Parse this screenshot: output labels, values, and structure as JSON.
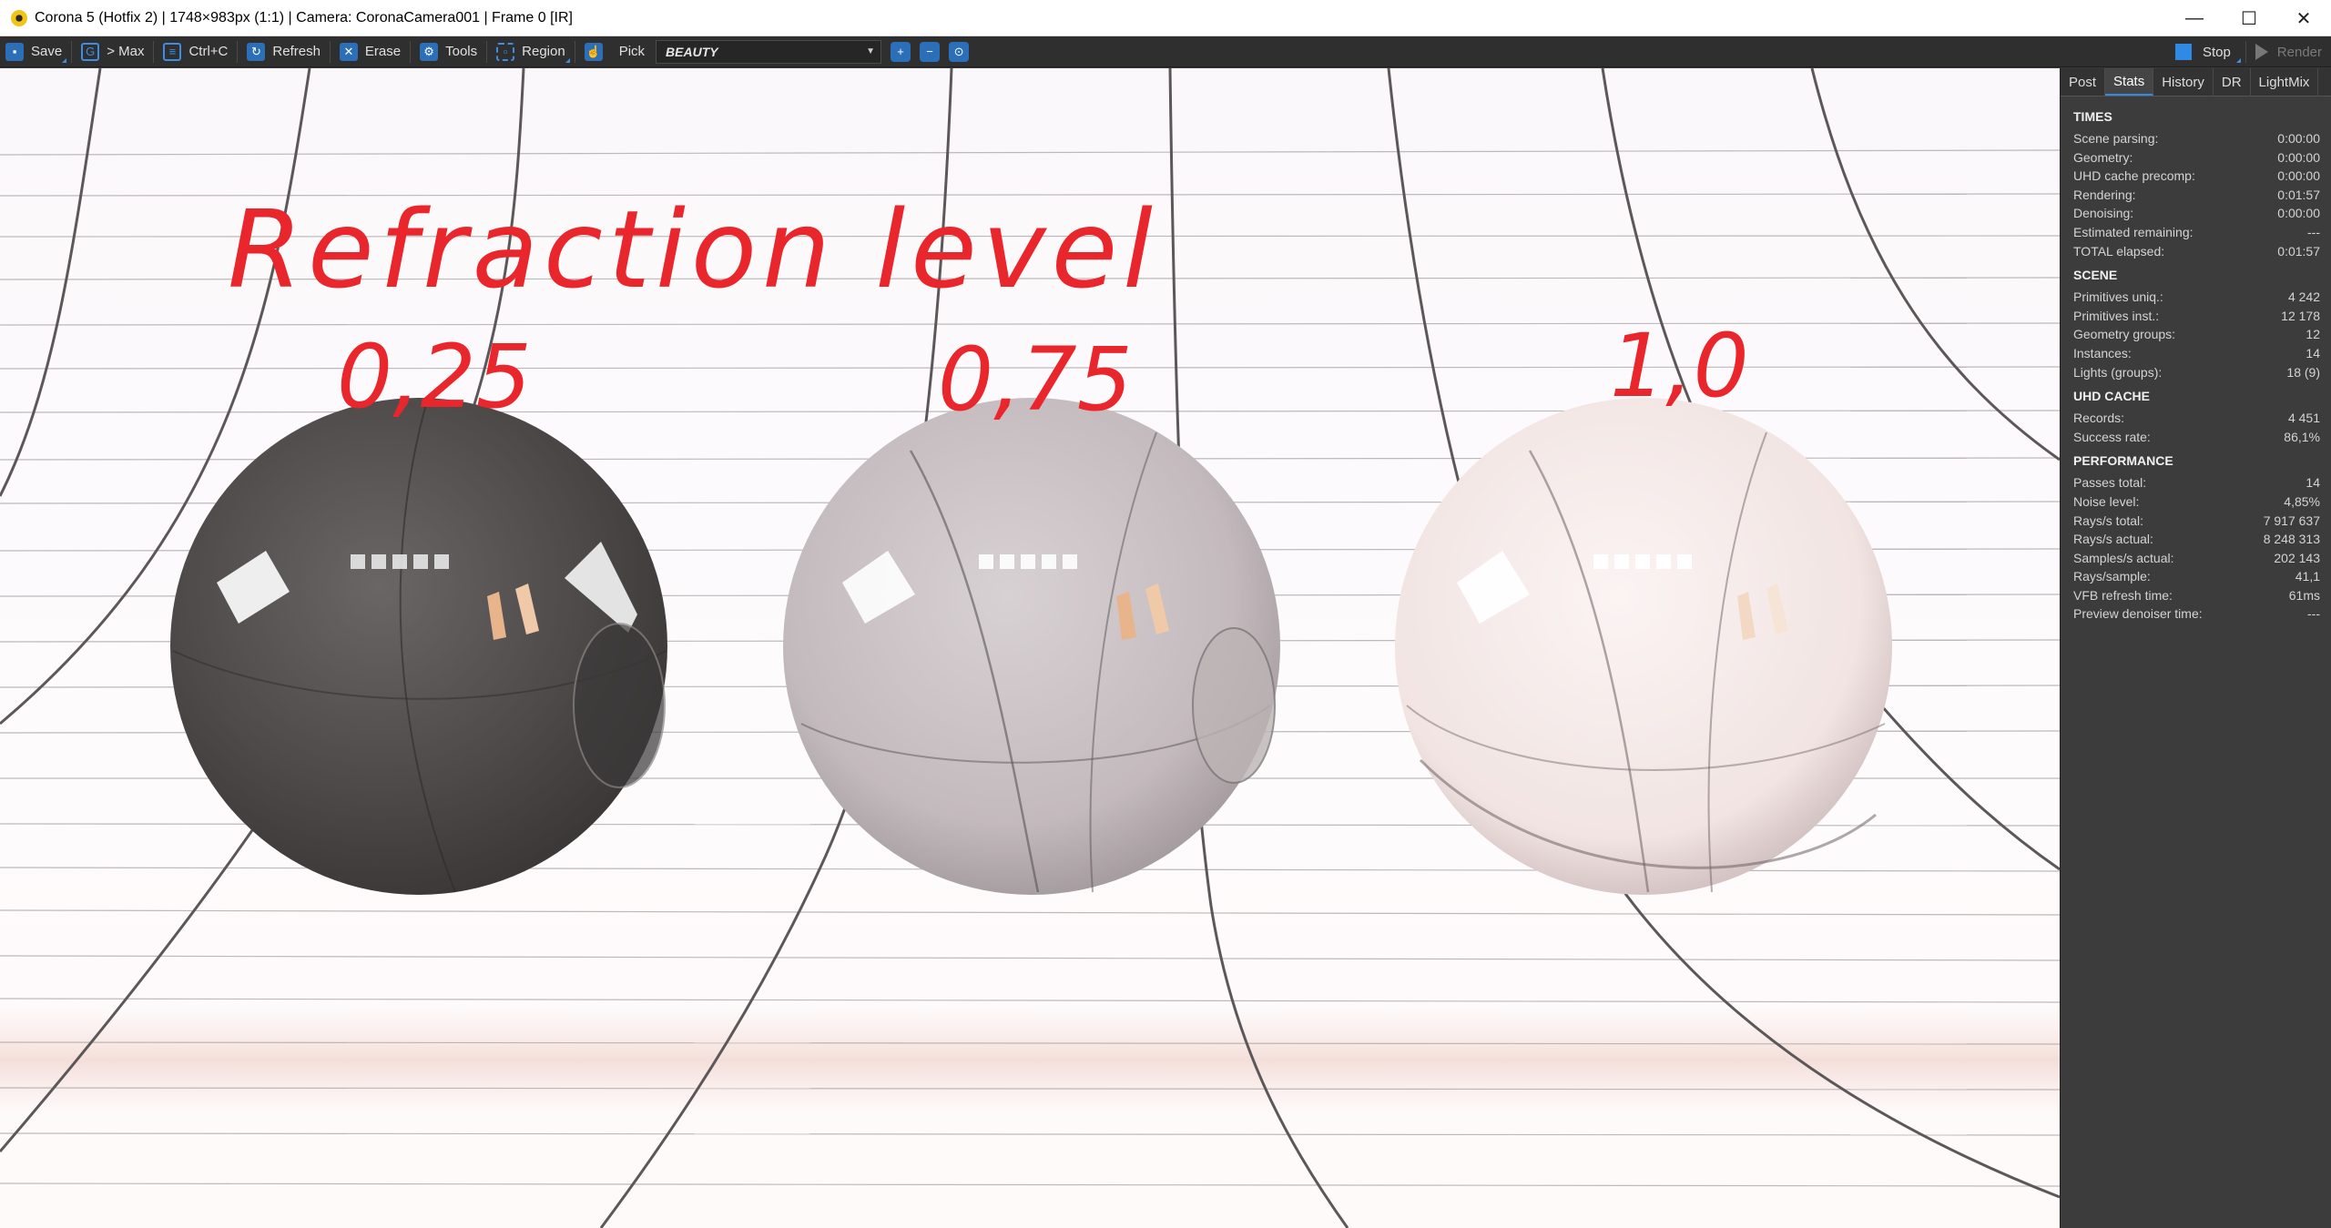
{
  "window": {
    "title": "Corona 5 (Hotfix 2) | 1748×983px (1:1) | Camera: CoronaCamera001 | Frame 0 [IR]",
    "controls": {
      "minimize": "—",
      "maximize": "☐",
      "close": "✕"
    }
  },
  "toolbar": {
    "save": "Save",
    "to_max": "> Max",
    "copy": "Ctrl+C",
    "refresh": "Refresh",
    "erase": "Erase",
    "tools": "Tools",
    "region": "Region",
    "pick": "Pick",
    "pass": "BEAUTY",
    "stop": "Stop",
    "render": "Render"
  },
  "viewport": {
    "annotation_title": "Refraction level",
    "labels": [
      "0,25",
      "0,75",
      "1,0"
    ],
    "annotation_color": "#e8262b"
  },
  "panel": {
    "tabs": [
      "Post",
      "Stats",
      "History",
      "DR",
      "LightMix"
    ],
    "active_tab": "Stats",
    "sections": [
      {
        "title": "TIMES",
        "rows": [
          {
            "label": "Scene parsing:",
            "value": "0:00:00"
          },
          {
            "label": "Geometry:",
            "value": "0:00:00"
          },
          {
            "label": "UHD cache precomp:",
            "value": "0:00:00"
          },
          {
            "label": "Rendering:",
            "value": "0:01:57"
          },
          {
            "label": "Denoising:",
            "value": "0:00:00"
          },
          {
            "label": "Estimated remaining:",
            "value": "---"
          },
          {
            "label": "TOTAL elapsed:",
            "value": "0:01:57"
          }
        ]
      },
      {
        "title": "SCENE",
        "rows": [
          {
            "label": "Primitives uniq.:",
            "value": "4 242"
          },
          {
            "label": "Primitives inst.:",
            "value": "12 178"
          },
          {
            "label": "Geometry groups:",
            "value": "12"
          },
          {
            "label": "Instances:",
            "value": "14"
          },
          {
            "label": "Lights (groups):",
            "value": "18 (9)"
          }
        ]
      },
      {
        "title": "UHD CACHE",
        "rows": [
          {
            "label": "Records:",
            "value": "4 451"
          },
          {
            "label": "Success rate:",
            "value": "86,1%"
          }
        ]
      },
      {
        "title": "PERFORMANCE",
        "rows": [
          {
            "label": "Passes total:",
            "value": "14"
          },
          {
            "label": "Noise level:",
            "value": "4,85%"
          },
          {
            "label": "Rays/s total:",
            "value": "7 917 637"
          },
          {
            "label": "Rays/s actual:",
            "value": "8 248 313"
          },
          {
            "label": "Samples/s actual:",
            "value": "202 143"
          },
          {
            "label": "Rays/sample:",
            "value": "41,1"
          },
          {
            "label": "VFB refresh time:",
            "value": "61ms"
          },
          {
            "label": "Preview denoiser time:",
            "value": "---"
          }
        ]
      }
    ]
  },
  "colors": {
    "accent": "#2f8ae6",
    "toolbar_bg": "#2f2f2f",
    "panel_bg": "#3c3c3c"
  }
}
